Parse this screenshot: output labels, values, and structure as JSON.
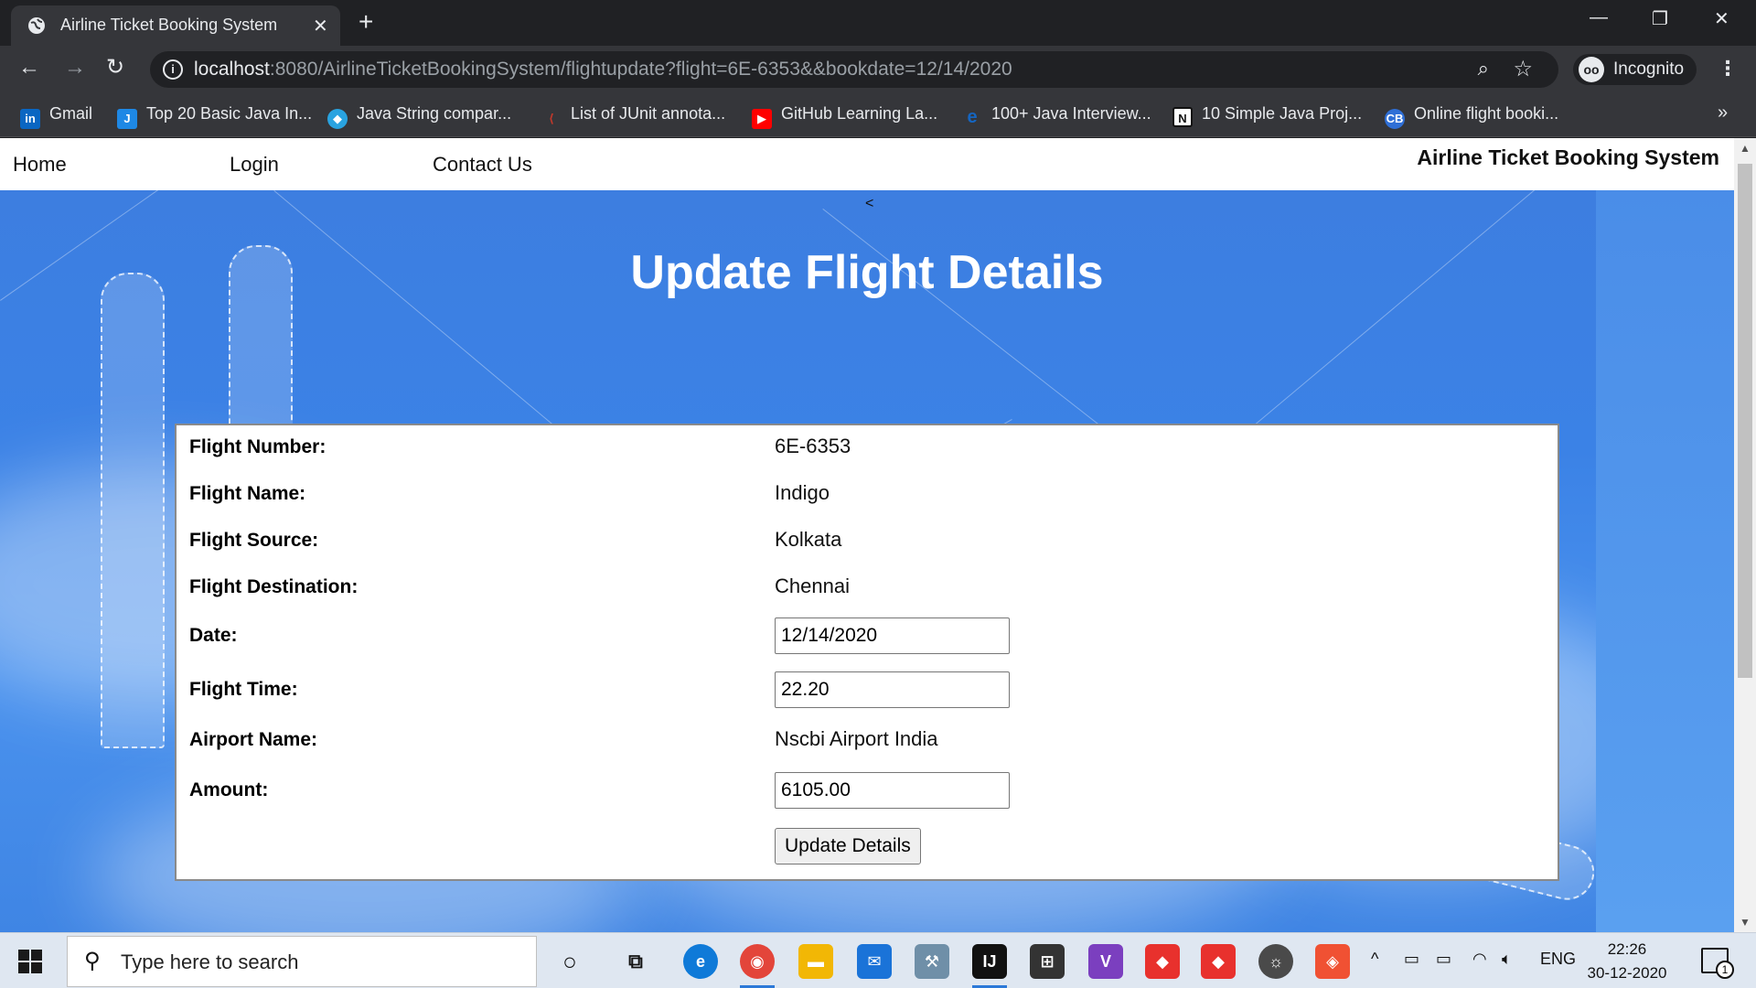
{
  "browser": {
    "tab_title": "Airline Ticket Booking System",
    "url_host": "localhost",
    "url_rest": ":8080/AirlineTicketBookingSystem/flightupdate?flight=6E-6353&&bookdate=12/14/2020",
    "profile_label": "Incognito",
    "bookmarks": [
      {
        "label": "Gmail",
        "icon": "linkedin-icon",
        "color": "#0a66c2"
      },
      {
        "label": "Top 20 Basic Java In...",
        "icon": "java-guide-icon",
        "color": "#1e88e5"
      },
      {
        "label": "Java String compar...",
        "icon": "diamond-icon",
        "color": "#29a3e0"
      },
      {
        "label": "List of JUnit annota...",
        "icon": "junit-icon",
        "color": "#c0392b"
      },
      {
        "label": "GitHub Learning La...",
        "icon": "youtube-icon",
        "color": "#ff0000"
      },
      {
        "label": "100+ Java Interview...",
        "icon": "edureka-icon",
        "color": "#1565c0"
      },
      {
        "label": "10 Simple Java Proj...",
        "icon": "notion-icon",
        "color": "#111111"
      },
      {
        "label": "Online flight booki...",
        "icon": "codebun-icon",
        "color": "#2f6fd6"
      }
    ]
  },
  "site": {
    "nav": [
      "Home",
      "Login",
      "Contact Us"
    ],
    "brand": "Airline Ticket Booking System",
    "back_marker": "<",
    "heading": "Update Flight Details"
  },
  "form": {
    "flight_number_label": "Flight Number:",
    "flight_number": "6E-6353",
    "flight_name_label": "Flight Name:",
    "flight_name": "Indigo",
    "source_label": "Flight Source:",
    "source": "Kolkata",
    "destination_label": "Flight Destination:",
    "destination": "Chennai",
    "date_label": "Date:",
    "date_value": "12/14/2020",
    "time_label": "Flight Time:",
    "time_value": "22.20",
    "airport_label": "Airport Name:",
    "airport": "Nscbi Airport India",
    "amount_label": "Amount:",
    "amount_value": "6105.00",
    "submit_label": "Update Details"
  },
  "taskbar": {
    "search_placeholder": "Type here to search",
    "language": "ENG",
    "time": "22:26",
    "date": "30-12-2020",
    "notification_count": "1"
  },
  "colors": {
    "sky": "#3b82e6",
    "chrome_dark": "#202124",
    "chrome_mid": "#35363a",
    "taskbar": "#dfe7f1"
  }
}
